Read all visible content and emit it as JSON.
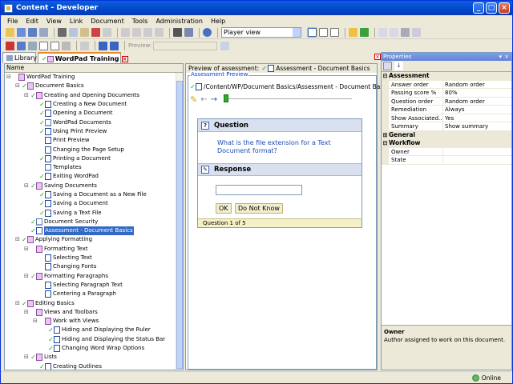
{
  "window": {
    "title": "Content - Developer"
  },
  "menubar": [
    "File",
    "Edit",
    "View",
    "Link",
    "Document",
    "Tools",
    "Administration",
    "Help"
  ],
  "toolbar": {
    "view_select": "Player view",
    "preview_label": "Preview:"
  },
  "tabs": [
    {
      "label": "Library"
    },
    {
      "label": "WordPad Training"
    }
  ],
  "tree": {
    "header": "Name",
    "rows": [
      {
        "label": "WordPad Training",
        "level": 0,
        "icon": "book",
        "check": false,
        "toggle": "-"
      },
      {
        "label": "Document Basics",
        "level": 1,
        "icon": "book",
        "check": true,
        "toggle": "-"
      },
      {
        "label": "Creating and Opening Documents",
        "level": 2,
        "icon": "book",
        "check": true,
        "toggle": "-"
      },
      {
        "label": "Creating a New Document",
        "level": 3,
        "icon": "q",
        "check": true,
        "toggle": ""
      },
      {
        "label": "Opening a Document",
        "level": 3,
        "icon": "q",
        "check": true,
        "toggle": ""
      },
      {
        "label": "WordPad Documents",
        "level": 3,
        "icon": "page",
        "check": true,
        "toggle": ""
      },
      {
        "label": "Using Print Preview",
        "level": 3,
        "icon": "q",
        "check": true,
        "toggle": ""
      },
      {
        "label": "Print Preview",
        "level": 3,
        "icon": "q",
        "check": false,
        "toggle": ""
      },
      {
        "label": "Changing the Page Setup",
        "level": 3,
        "icon": "q",
        "check": false,
        "toggle": ""
      },
      {
        "label": "Printing a Document",
        "level": 3,
        "icon": "q",
        "check": true,
        "toggle": ""
      },
      {
        "label": "Templates",
        "level": 3,
        "icon": "page",
        "check": false,
        "toggle": ""
      },
      {
        "label": "Exiting WordPad",
        "level": 3,
        "icon": "q",
        "check": true,
        "toggle": ""
      },
      {
        "label": "Saving Documents",
        "level": 2,
        "icon": "book",
        "check": true,
        "toggle": "-"
      },
      {
        "label": "Saving a Document as a New File",
        "level": 3,
        "icon": "q",
        "check": true,
        "toggle": ""
      },
      {
        "label": "Saving a Document",
        "level": 3,
        "icon": "q",
        "check": true,
        "toggle": ""
      },
      {
        "label": "Saving a Text File",
        "level": 3,
        "icon": "q",
        "check": true,
        "toggle": ""
      },
      {
        "label": "Document Security",
        "level": 2,
        "icon": "page",
        "check": true,
        "toggle": ""
      },
      {
        "label": "Assessment - Document Basics",
        "level": 2,
        "icon": "q",
        "check": true,
        "toggle": "",
        "selected": true
      },
      {
        "label": "Applying Formatting",
        "level": 1,
        "icon": "book",
        "check": true,
        "toggle": "-"
      },
      {
        "label": "Formatting Text",
        "level": 2,
        "icon": "book",
        "check": false,
        "toggle": "-"
      },
      {
        "label": "Selecting Text",
        "level": 3,
        "icon": "q",
        "check": false,
        "toggle": ""
      },
      {
        "label": "Changing Fonts",
        "level": 3,
        "icon": "q",
        "check": false,
        "toggle": ""
      },
      {
        "label": "Formatting Paragraphs",
        "level": 2,
        "icon": "book",
        "check": true,
        "toggle": "-"
      },
      {
        "label": "Selecting Paragraph Text",
        "level": 3,
        "icon": "q",
        "check": false,
        "toggle": ""
      },
      {
        "label": "Centering a Paragraph",
        "level": 3,
        "icon": "q",
        "check": false,
        "toggle": ""
      },
      {
        "label": "Editing Basics",
        "level": 1,
        "icon": "book",
        "check": true,
        "toggle": "-"
      },
      {
        "label": "Views and Toolbars",
        "level": 2,
        "icon": "book",
        "check": false,
        "toggle": "-"
      },
      {
        "label": "Work with Views",
        "level": 3,
        "icon": "book",
        "check": false,
        "toggle": "-"
      },
      {
        "label": "Hiding and Displaying the Ruler",
        "level": 4,
        "icon": "q",
        "check": true,
        "toggle": ""
      },
      {
        "label": "Hiding and Displaying the Status Bar",
        "level": 4,
        "icon": "q",
        "check": true,
        "toggle": ""
      },
      {
        "label": "Changing Word Wrap Options",
        "level": 4,
        "icon": "q",
        "check": true,
        "toggle": ""
      },
      {
        "label": "Lists",
        "level": 2,
        "icon": "book",
        "check": true,
        "toggle": "-"
      },
      {
        "label": "Creating Outlines",
        "level": 3,
        "icon": "q",
        "check": true,
        "toggle": ""
      }
    ]
  },
  "preview": {
    "header_label": "Preview of assessment:",
    "header_doc": "Assessment - Document Basics",
    "frame_title": "Assessment Preview",
    "path": "/Content/WP/Document Basics/Assessment - Document Basics",
    "question_heading": "Question",
    "question_text": "What is the file extension for a Text Document format?",
    "response_heading": "Response",
    "ok_label": "OK",
    "dont_know_label": "Do Not Know",
    "footer": "Question 1 of 5"
  },
  "properties": {
    "title": "Properties",
    "categories": [
      {
        "name": "Assessment",
        "expanded": true,
        "rows": [
          {
            "k": "Answer order",
            "v": "Random order"
          },
          {
            "k": "Passing score %",
            "v": "80%"
          },
          {
            "k": "Question order",
            "v": "Random order"
          },
          {
            "k": "Remediation",
            "v": "Always"
          },
          {
            "k": "Show Associated...",
            "v": "Yes"
          },
          {
            "k": "Summary",
            "v": "Show summary"
          }
        ]
      },
      {
        "name": "General",
        "expanded": false,
        "rows": []
      },
      {
        "name": "Workflow",
        "expanded": true,
        "rows": [
          {
            "k": "Owner",
            "v": ""
          },
          {
            "k": "State",
            "v": ""
          }
        ]
      }
    ],
    "desc_title": "Owner",
    "desc_text": "Author assigned to work on this document."
  },
  "status": {
    "online": "Online"
  },
  "colors": {
    "check": "#1a9c1a",
    "accent": "#0046d5",
    "selection": "#316ac5"
  }
}
